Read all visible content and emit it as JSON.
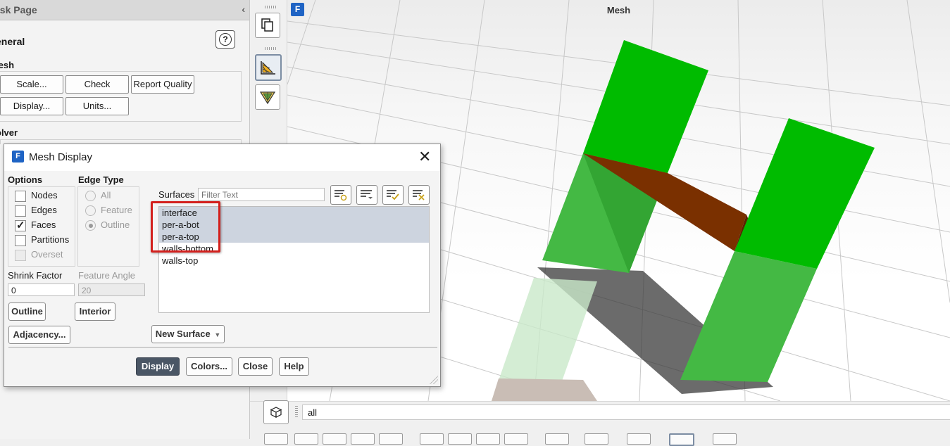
{
  "task_page": {
    "title": "ask Page",
    "general_heading": "eneral",
    "mesh_heading": "lesh",
    "mesh_buttons": [
      "Scale...",
      "Check",
      "Report Quality",
      "Display...",
      "Units..."
    ],
    "solver_heading": "olver"
  },
  "viewport": {
    "title": "Mesh"
  },
  "bottom_bar": {
    "surface_filter_value": "all"
  },
  "dialog": {
    "title": "Mesh Display",
    "options_label": "Options",
    "options": [
      {
        "label": "Nodes",
        "checked": false,
        "enabled": true
      },
      {
        "label": "Edges",
        "checked": false,
        "enabled": true
      },
      {
        "label": "Faces",
        "checked": true,
        "enabled": true
      },
      {
        "label": "Partitions",
        "checked": false,
        "enabled": true
      },
      {
        "label": "Overset",
        "checked": false,
        "enabled": false
      }
    ],
    "edge_type_label": "Edge Type",
    "edge_types": [
      {
        "label": "All",
        "selected": false
      },
      {
        "label": "Feature",
        "selected": false
      },
      {
        "label": "Outline",
        "selected": true
      }
    ],
    "surfaces_label": "Surfaces",
    "filter_placeholder": "Filter Text",
    "surfaces": [
      {
        "name": "interface",
        "selected": true
      },
      {
        "name": "per-a-bot",
        "selected": true
      },
      {
        "name": "per-a-top",
        "selected": true
      },
      {
        "name": "walls-bottom",
        "selected": false
      },
      {
        "name": "walls-top",
        "selected": false
      }
    ],
    "shrink_factor_label": "Shrink Factor",
    "shrink_factor_value": "0",
    "feature_angle_label": "Feature Angle",
    "feature_angle_value": "20",
    "outline_button": "Outline",
    "interior_button": "Interior",
    "adjacency_button": "Adjacency...",
    "new_surface_button": "New Surface",
    "footer_buttons": [
      "Display",
      "Colors...",
      "Close",
      "Help"
    ]
  },
  "colors": {
    "surface_green": "#00bb00",
    "surface_green_light": "#44b944",
    "interface_brown": "#7a3000",
    "highlight_red": "#d3201d",
    "primary_button": "#4a5665"
  }
}
